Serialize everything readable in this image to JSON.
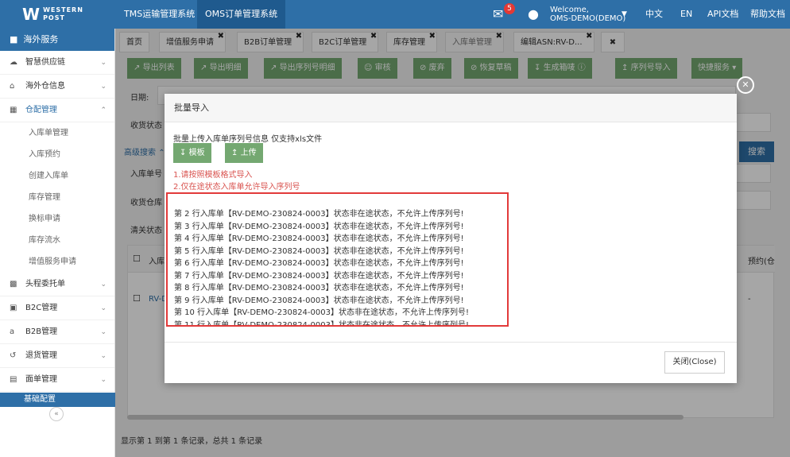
{
  "brand": {
    "mark": "W",
    "line1": "WESTERN",
    "line2": "POST"
  },
  "topbar": {
    "sys_tabs": [
      "TMS运输管理系统",
      "OMS订单管理系统"
    ],
    "mail_count": "5",
    "welcome_line1": "Welcome,",
    "welcome_line2": "OMS-DEMO(DEMO)",
    "lang_zh": "中文",
    "lang_en": "EN",
    "api_doc": "API文档",
    "help_doc": "帮助文档"
  },
  "sidebar": {
    "header": "海外服务",
    "items": [
      {
        "label": "智慧供应链"
      },
      {
        "label": "海外仓信息"
      },
      {
        "label": "仓配管理"
      },
      {
        "label": "头程委托单"
      },
      {
        "label": "B2C管理"
      },
      {
        "label": "B2B管理"
      },
      {
        "label": "退货管理"
      },
      {
        "label": "面单管理"
      }
    ],
    "subitems": [
      "入库单管理",
      "入库预约",
      "创建入库单",
      "库存管理",
      "换标申请",
      "库存流水",
      "增值服务申请"
    ],
    "footer": "基础配置"
  },
  "tabs": [
    "首页",
    "增值服务申请",
    "B2B订单管理",
    "B2C订单管理",
    "库存管理",
    "入库单管理",
    "编辑ASN:RV-D..."
  ],
  "toolbar": [
    "导出列表",
    "导出明细",
    "导出序列号明细",
    "审核",
    "废弃",
    "恢复草稿",
    "生成箱唛",
    "序列号导入",
    "快捷服务"
  ],
  "background": {
    "date_label": "日期:",
    "recv_status_label": "收货状态",
    "advanced_search": "高级搜索",
    "inbound_no_label": "入库单号",
    "recv_wh_label": "收货仓库",
    "clear_status_label": "清关状态",
    "col_inbound": "入库",
    "col_appt": "预约(仓",
    "row_link": "RV-D",
    "row_dash": "-",
    "search_btn": "搜索",
    "footer": "显示第 1 到第 1 条记录，总共 1 条记录"
  },
  "modal": {
    "title": "批量导入",
    "description": "批量上传入库单序列号信息 仅支持xls文件",
    "template_btn": "模板",
    "upload_btn": "上传",
    "notes": [
      "1.请按照模板格式导入",
      "2.仅在途状态入库单允许导入序列号"
    ],
    "errors": [
      "第 2 行入库单【RV-DEMO-230824-0003】状态非在途状态，不允许上传序列号!",
      "第 3 行入库单【RV-DEMO-230824-0003】状态非在途状态，不允许上传序列号!",
      "第 4 行入库单【RV-DEMO-230824-0003】状态非在途状态，不允许上传序列号!",
      "第 5 行入库单【RV-DEMO-230824-0003】状态非在途状态，不允许上传序列号!",
      "第 6 行入库单【RV-DEMO-230824-0003】状态非在途状态，不允许上传序列号!",
      "第 7 行入库单【RV-DEMO-230824-0003】状态非在途状态，不允许上传序列号!",
      "第 8 行入库单【RV-DEMO-230824-0003】状态非在途状态，不允许上传序列号!",
      "第 9 行入库单【RV-DEMO-230824-0003】状态非在途状态，不允许上传序列号!",
      "第 10 行入库单【RV-DEMO-230824-0003】状态非在途状态，不允许上传序列号!",
      "第 11 行入库单【RV-DEMO-230824-0003】状态非在途状态，不允许上传序列号!"
    ],
    "close_btn": "关闭(Close)"
  },
  "colors": {
    "primary": "#2e6fa7",
    "button_green": "#74a871",
    "error_border": "#e23a3a",
    "note_red": "#d9534f"
  }
}
